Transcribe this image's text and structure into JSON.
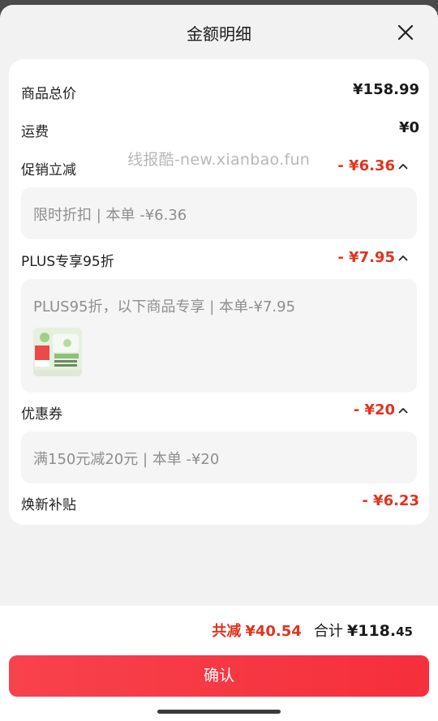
{
  "header": {
    "title": "金额明细",
    "close_icon": "close-icon"
  },
  "rows": {
    "goods_total": {
      "label": "商品总价",
      "value": "¥158.99"
    },
    "shipping": {
      "label": "运费",
      "value": "¥0"
    },
    "promo": {
      "label": "促销立减",
      "value": "- ¥6.36",
      "detail": "限时折扣 | 本单 -¥6.36"
    },
    "plus": {
      "label": "PLUS专享95折",
      "value": "- ¥7.95",
      "detail": "PLUS95折，以下商品专享 | 本单-¥7.95"
    },
    "coupon": {
      "label": "优惠券",
      "value": "- ¥20",
      "detail": "满150元减20元 | 本单 -¥20"
    },
    "trade_in": {
      "label": "焕新补贴",
      "value": "- ¥6.23"
    }
  },
  "watermark": "线报酷-new.xianbao.fun",
  "footer": {
    "saving_label": "共减",
    "saving_value": "¥40.54",
    "total_label": "合计",
    "total_main": "¥118.",
    "total_decimal": "45",
    "confirm_label": "确认"
  },
  "colors": {
    "accent_red": "#e3331e",
    "button_red": "#f52f3b",
    "card_bg": "#ffffff",
    "sheet_bg": "#f2f2f2"
  }
}
